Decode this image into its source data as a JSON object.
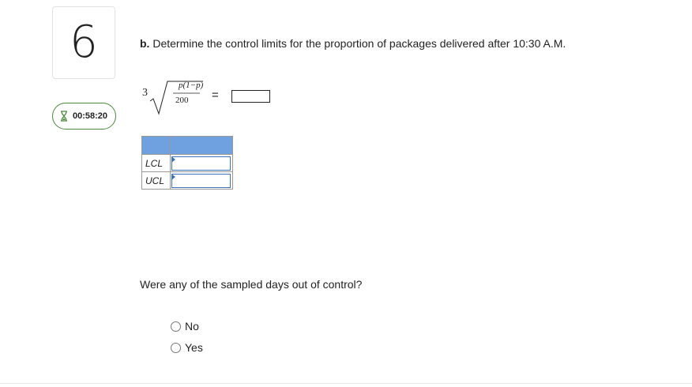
{
  "question": {
    "number": "6"
  },
  "timer": {
    "icon": "hourglass-icon",
    "value": "00:58:20",
    "border_color": "#4a8a3a"
  },
  "part_b": {
    "label": "b.",
    "prompt": "Determine the control limits for the proportion of packages delivered after 10:30 A.M."
  },
  "formula": {
    "coefficient": "3",
    "numerator": "p(1−p)",
    "denominator": "200",
    "equals": "=",
    "answer_value": ""
  },
  "limits_table": {
    "header_color": "#6fa0e0",
    "rows": [
      {
        "label": "LCL",
        "value": ""
      },
      {
        "label": "UCL",
        "value": ""
      }
    ]
  },
  "out_of_control": {
    "question": "Were any of the sampled days out of control?",
    "options": [
      {
        "label": "No",
        "selected": false
      },
      {
        "label": "Yes",
        "selected": false
      }
    ]
  }
}
